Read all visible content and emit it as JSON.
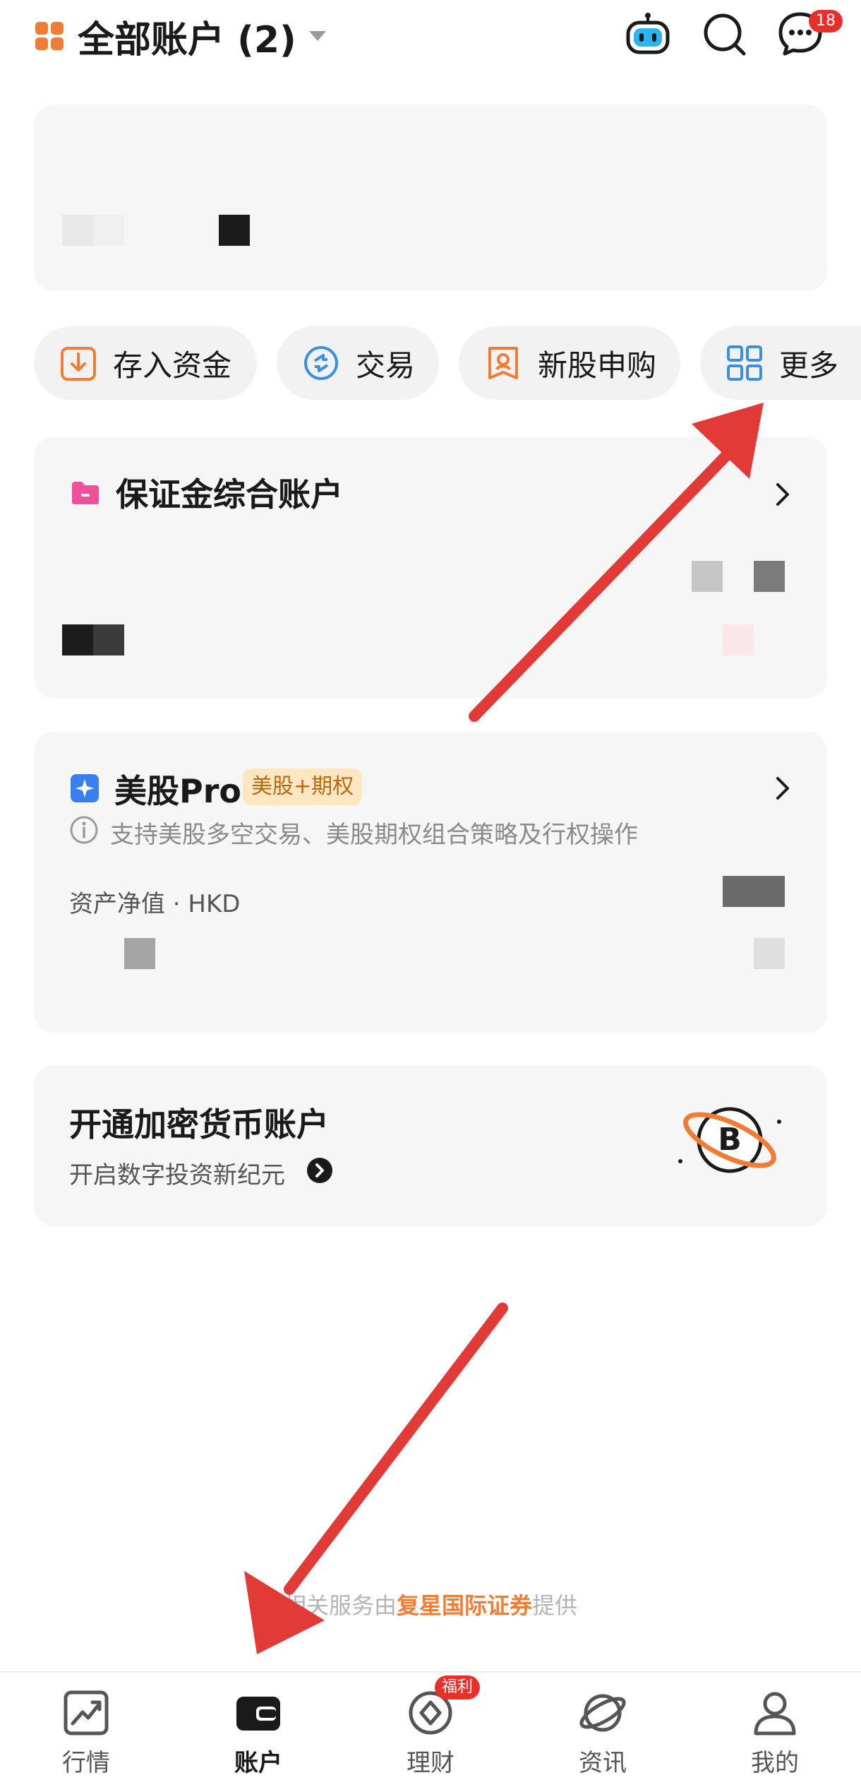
{
  "header": {
    "title": "全部账户 (2)",
    "message_badge": "18"
  },
  "quick_actions": [
    {
      "label": "存入资金",
      "icon": "deposit-icon"
    },
    {
      "label": "交易",
      "icon": "trade-icon"
    },
    {
      "label": "新股申购",
      "icon": "ipo-icon"
    },
    {
      "label": "更多",
      "icon": "grid-icon"
    }
  ],
  "margin_account": {
    "title": "保证金综合账户"
  },
  "us_pro": {
    "title": "美股Pro",
    "tag": "美股+期权",
    "desc": "支持美股多空交易、美股期权组合策略及行权操作",
    "asset_label": "资产净值 · HKD"
  },
  "crypto": {
    "title": "开通加密货币账户",
    "subtitle": "开启数字投资新纪元"
  },
  "footer": {
    "prefix": "相关服务由",
    "provider": "复星国际证券",
    "suffix": "提供"
  },
  "tabbar": {
    "items": [
      {
        "label": "行情",
        "icon": "chart-icon"
      },
      {
        "label": "账户",
        "icon": "wallet-icon"
      },
      {
        "label": "理财",
        "icon": "coin-icon",
        "badge": "福利"
      },
      {
        "label": "资讯",
        "icon": "planet-icon"
      },
      {
        "label": "我的",
        "icon": "person-icon"
      }
    ]
  },
  "colors": {
    "accent_orange": "#ef7d35",
    "accent_blue": "#3a8ee6",
    "arrow_red": "#e23a36",
    "card_bg": "#f6f6f6"
  }
}
